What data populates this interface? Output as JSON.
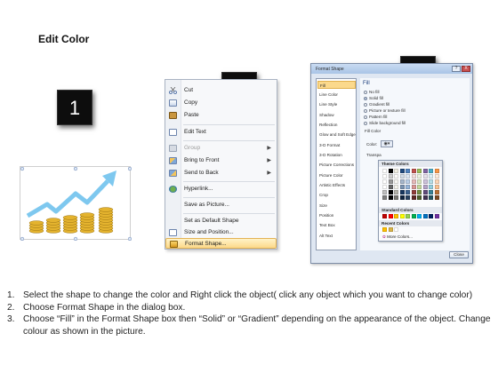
{
  "title": "Edit Color",
  "steps": {
    "one": "1",
    "two": "2",
    "three": "3"
  },
  "context_menu": {
    "items": [
      {
        "label": "Cut",
        "icon": "scissors-icon"
      },
      {
        "label": "Copy",
        "icon": "copy-icon"
      },
      {
        "label": "Paste",
        "icon": "paste-icon"
      },
      {
        "label": "Edit Text",
        "icon": "edit-text-icon"
      },
      {
        "label": "Group",
        "icon": "group-icon",
        "disabled": true,
        "submenu": true
      },
      {
        "label": "Bring to Front",
        "icon": "bring-front-icon",
        "submenu": true
      },
      {
        "label": "Send to Back",
        "icon": "send-back-icon",
        "submenu": true
      },
      {
        "label": "Hyperlink...",
        "icon": "hyperlink-icon"
      },
      {
        "label": "Save as Picture...",
        "icon": ""
      },
      {
        "label": "Set as Default Shape",
        "icon": ""
      },
      {
        "label": "Size and Position...",
        "icon": "size-position-icon"
      },
      {
        "label": "Format Shape...",
        "icon": "format-shape-icon",
        "highlighted": true
      }
    ]
  },
  "dialog": {
    "title": "Format Shape",
    "help": "?",
    "close": "X",
    "categories": [
      "Fill",
      "Line Color",
      "Line Style",
      "Shadow",
      "Reflection",
      "Glow and Soft Edges",
      "3-D Format",
      "3-D Rotation",
      "Picture Corrections",
      "Picture Color",
      "Artistic Effects",
      "Crop",
      "Size",
      "Position",
      "Text Box",
      "Alt Text"
    ],
    "selected_category": "Fill",
    "panel_heading": "Fill",
    "fill_options": [
      {
        "label": "No fill",
        "checked": false
      },
      {
        "label": "Solid fill",
        "checked": true
      },
      {
        "label": "Gradient fill",
        "checked": false
      },
      {
        "label": "Picture or texture fill",
        "checked": false
      },
      {
        "label": "Pattern fill",
        "checked": false
      },
      {
        "label": "Slide background fill",
        "checked": false
      }
    ],
    "fill_color_label": "Fill Color",
    "color_label": "Color:",
    "transparency_label": "Transpa",
    "close_button": "Close"
  },
  "palette": {
    "theme_header": "Theme Colors",
    "standard_header": "Standard Colors",
    "recent_header": "Recent Colors",
    "more_colors": "More Colors...",
    "theme_top": [
      "#ffffff",
      "#000000",
      "#eeece1",
      "#1f497d",
      "#4f81bd",
      "#c0504d",
      "#9bbb59",
      "#8064a2",
      "#4bacc6",
      "#f79646"
    ],
    "standard": [
      "#c00000",
      "#ff0000",
      "#ffc000",
      "#ffff00",
      "#92d050",
      "#00b050",
      "#00b0f0",
      "#0070c0",
      "#002060",
      "#7030a0"
    ],
    "recent": [
      "#ffc000",
      "#d9b44a",
      "#ffffff"
    ]
  },
  "instructions": [
    {
      "num": "1.",
      "text": "Select the shape to change the color and Right click the object( click any object which you want to change color)"
    },
    {
      "num": "2.",
      "text": "Choose Format Shape in the dialog box."
    },
    {
      "num": "3.",
      "text": "Choose “Fill” in the Format Shape box then “Solid” or “Gradient” depending on the appearance of the object. Change colour as shown in the picture."
    }
  ]
}
